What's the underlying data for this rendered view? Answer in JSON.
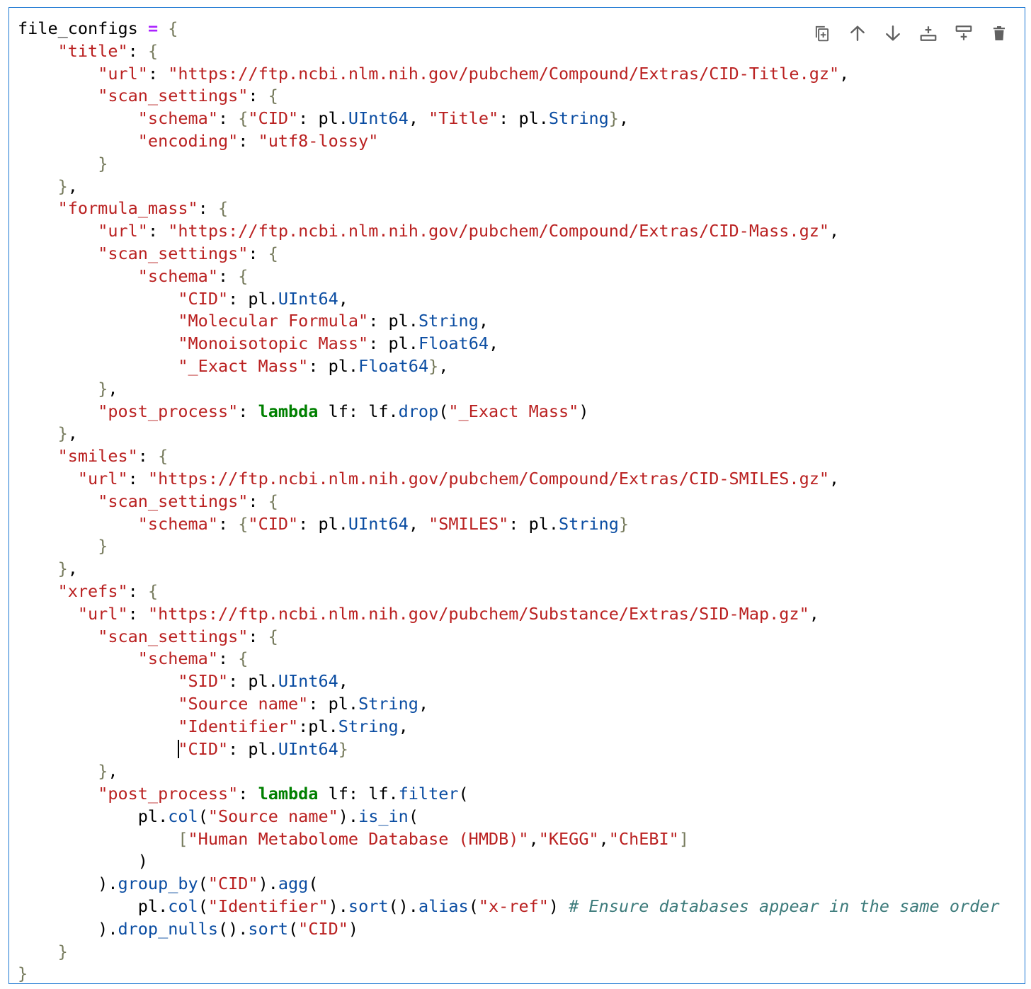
{
  "toolbar": {
    "buttons": [
      {
        "name": "duplicate-cell-button",
        "icon": "duplicate-icon"
      },
      {
        "name": "move-up-button",
        "icon": "arrow-up-icon"
      },
      {
        "name": "move-down-button",
        "icon": "arrow-down-icon"
      },
      {
        "name": "insert-above-button",
        "icon": "insert-above-icon"
      },
      {
        "name": "insert-below-button",
        "icon": "insert-below-icon"
      },
      {
        "name": "delete-cell-button",
        "icon": "trash-icon"
      }
    ],
    "icon_color": "#616161"
  },
  "editor": {
    "cursor_line": 32,
    "accent": "#1976d2",
    "lines": [
      [
        [
          "file_configs ",
          "default"
        ],
        [
          "=",
          "op"
        ],
        [
          " ",
          "default"
        ],
        [
          "{",
          "brace"
        ]
      ],
      [
        [
          "    ",
          "default"
        ],
        [
          "\"title\"",
          "key"
        ],
        [
          ": ",
          "default"
        ],
        [
          "{",
          "brace"
        ]
      ],
      [
        [
          "        ",
          "default"
        ],
        [
          "\"url\"",
          "key"
        ],
        [
          ": ",
          "default"
        ],
        [
          "\"https://ftp.ncbi.nlm.nih.gov/pubchem/Compound/Extras/CID-Title.gz\"",
          "string"
        ],
        [
          ",",
          "default"
        ]
      ],
      [
        [
          "        ",
          "default"
        ],
        [
          "\"scan_settings\"",
          "key"
        ],
        [
          ": ",
          "default"
        ],
        [
          "{",
          "brace"
        ]
      ],
      [
        [
          "            ",
          "default"
        ],
        [
          "\"schema\"",
          "key"
        ],
        [
          ": ",
          "default"
        ],
        [
          "{",
          "brace"
        ],
        [
          "\"CID\"",
          "string"
        ],
        [
          ": pl.",
          "default"
        ],
        [
          "UInt64",
          "attr"
        ],
        [
          ", ",
          "default"
        ],
        [
          "\"Title\"",
          "string"
        ],
        [
          ": pl.",
          "default"
        ],
        [
          "String",
          "attr"
        ],
        [
          "}",
          "brace"
        ],
        [
          ",",
          "default"
        ]
      ],
      [
        [
          "            ",
          "default"
        ],
        [
          "\"encoding\"",
          "key"
        ],
        [
          ": ",
          "default"
        ],
        [
          "\"utf8-lossy\"",
          "string"
        ]
      ],
      [
        [
          "        ",
          "default"
        ],
        [
          "}",
          "brace"
        ]
      ],
      [
        [
          "    ",
          "default"
        ],
        [
          "}",
          "brace"
        ],
        [
          ",",
          "default"
        ]
      ],
      [
        [
          "    ",
          "default"
        ],
        [
          "\"formula_mass\"",
          "key"
        ],
        [
          ": ",
          "default"
        ],
        [
          "{",
          "brace"
        ]
      ],
      [
        [
          "        ",
          "default"
        ],
        [
          "\"url\"",
          "key"
        ],
        [
          ": ",
          "default"
        ],
        [
          "\"https://ftp.ncbi.nlm.nih.gov/pubchem/Compound/Extras/CID-Mass.gz\"",
          "string"
        ],
        [
          ",",
          "default"
        ]
      ],
      [
        [
          "        ",
          "default"
        ],
        [
          "\"scan_settings\"",
          "key"
        ],
        [
          ": ",
          "default"
        ],
        [
          "{",
          "brace"
        ]
      ],
      [
        [
          "            ",
          "default"
        ],
        [
          "\"schema\"",
          "key"
        ],
        [
          ": ",
          "default"
        ],
        [
          "{",
          "brace"
        ]
      ],
      [
        [
          "                ",
          "default"
        ],
        [
          "\"CID\"",
          "string"
        ],
        [
          ": pl.",
          "default"
        ],
        [
          "UInt64",
          "attr"
        ],
        [
          ",",
          "default"
        ]
      ],
      [
        [
          "                ",
          "default"
        ],
        [
          "\"Molecular Formula\"",
          "string"
        ],
        [
          ": pl.",
          "default"
        ],
        [
          "String",
          "attr"
        ],
        [
          ",",
          "default"
        ]
      ],
      [
        [
          "                ",
          "default"
        ],
        [
          "\"Monoisotopic Mass\"",
          "string"
        ],
        [
          ": pl.",
          "default"
        ],
        [
          "Float64",
          "attr"
        ],
        [
          ",",
          "default"
        ]
      ],
      [
        [
          "                ",
          "default"
        ],
        [
          "\"_Exact Mass\"",
          "string"
        ],
        [
          ": pl.",
          "default"
        ],
        [
          "Float64",
          "attr"
        ],
        [
          "}",
          "brace"
        ],
        [
          ",",
          "default"
        ]
      ],
      [
        [
          "        ",
          "default"
        ],
        [
          "}",
          "brace"
        ],
        [
          ",",
          "default"
        ]
      ],
      [
        [
          "        ",
          "default"
        ],
        [
          "\"post_process\"",
          "key"
        ],
        [
          ": ",
          "default"
        ],
        [
          "lambda",
          "keyword"
        ],
        [
          " lf: lf.",
          "default"
        ],
        [
          "drop",
          "attr"
        ],
        [
          "(",
          "default"
        ],
        [
          "\"_Exact Mass\"",
          "string"
        ],
        [
          ")",
          "default"
        ]
      ],
      [
        [
          "    ",
          "default"
        ],
        [
          "}",
          "brace"
        ],
        [
          ",",
          "default"
        ]
      ],
      [
        [
          "    ",
          "default"
        ],
        [
          "\"smiles\"",
          "key"
        ],
        [
          ": ",
          "default"
        ],
        [
          "{",
          "brace"
        ]
      ],
      [
        [
          "      ",
          "default"
        ],
        [
          "\"url\"",
          "key"
        ],
        [
          ": ",
          "default"
        ],
        [
          "\"https://ftp.ncbi.nlm.nih.gov/pubchem/Compound/Extras/CID-SMILES.gz\"",
          "string"
        ],
        [
          ",",
          "default"
        ]
      ],
      [
        [
          "        ",
          "default"
        ],
        [
          "\"scan_settings\"",
          "key"
        ],
        [
          ": ",
          "default"
        ],
        [
          "{",
          "brace"
        ]
      ],
      [
        [
          "            ",
          "default"
        ],
        [
          "\"schema\"",
          "key"
        ],
        [
          ": ",
          "default"
        ],
        [
          "{",
          "brace"
        ],
        [
          "\"CID\"",
          "string"
        ],
        [
          ": pl.",
          "default"
        ],
        [
          "UInt64",
          "attr"
        ],
        [
          ", ",
          "default"
        ],
        [
          "\"SMILES\"",
          "string"
        ],
        [
          ": pl.",
          "default"
        ],
        [
          "String",
          "attr"
        ],
        [
          "}",
          "brace"
        ]
      ],
      [
        [
          "        ",
          "default"
        ],
        [
          "}",
          "brace"
        ]
      ],
      [
        [
          "    ",
          "default"
        ],
        [
          "}",
          "brace"
        ],
        [
          ",",
          "default"
        ]
      ],
      [
        [
          "    ",
          "default"
        ],
        [
          "\"xrefs\"",
          "key"
        ],
        [
          ": ",
          "default"
        ],
        [
          "{",
          "brace"
        ]
      ],
      [
        [
          "      ",
          "default"
        ],
        [
          "\"url\"",
          "key"
        ],
        [
          ": ",
          "default"
        ],
        [
          "\"https://ftp.ncbi.nlm.nih.gov/pubchem/Substance/Extras/SID-Map.gz\"",
          "string"
        ],
        [
          ",",
          "default"
        ]
      ],
      [
        [
          "        ",
          "default"
        ],
        [
          "\"scan_settings\"",
          "key"
        ],
        [
          ": ",
          "default"
        ],
        [
          "{",
          "brace"
        ]
      ],
      [
        [
          "            ",
          "default"
        ],
        [
          "\"schema\"",
          "key"
        ],
        [
          ": ",
          "default"
        ],
        [
          "{",
          "brace"
        ]
      ],
      [
        [
          "                ",
          "default"
        ],
        [
          "\"SID\"",
          "string"
        ],
        [
          ": pl.",
          "default"
        ],
        [
          "UInt64",
          "attr"
        ],
        [
          ",",
          "default"
        ]
      ],
      [
        [
          "                ",
          "default"
        ],
        [
          "\"Source name\"",
          "string"
        ],
        [
          ": pl.",
          "default"
        ],
        [
          "String",
          "attr"
        ],
        [
          ",",
          "default"
        ]
      ],
      [
        [
          "                ",
          "default"
        ],
        [
          "\"Identifier\"",
          "string"
        ],
        [
          ":pl.",
          "default"
        ],
        [
          "String",
          "attr"
        ],
        [
          ",",
          "default"
        ]
      ],
      [
        [
          "                ",
          "default"
        ],
        [
          "\"CID\"",
          "string"
        ],
        [
          ": pl.",
          "default"
        ],
        [
          "UInt64",
          "attr"
        ],
        [
          "}",
          "brace"
        ]
      ],
      [
        [
          "        ",
          "default"
        ],
        [
          "}",
          "brace"
        ],
        [
          ",",
          "default"
        ]
      ],
      [
        [
          "        ",
          "default"
        ],
        [
          "\"post_process\"",
          "key"
        ],
        [
          ": ",
          "default"
        ],
        [
          "lambda",
          "keyword"
        ],
        [
          " lf: lf.",
          "default"
        ],
        [
          "filter",
          "attr"
        ],
        [
          "(",
          "default"
        ]
      ],
      [
        [
          "            pl.",
          "default"
        ],
        [
          "col",
          "attr"
        ],
        [
          "(",
          "default"
        ],
        [
          "\"Source name\"",
          "string"
        ],
        [
          ").",
          "default"
        ],
        [
          "is_in",
          "attr"
        ],
        [
          "(",
          "default"
        ]
      ],
      [
        [
          "                ",
          "default"
        ],
        [
          "[",
          "brace"
        ],
        [
          "\"Human Metabolome Database (HMDB)\"",
          "string"
        ],
        [
          ",",
          "default"
        ],
        [
          "\"KEGG\"",
          "string"
        ],
        [
          ",",
          "default"
        ],
        [
          "\"ChEBI\"",
          "string"
        ],
        [
          "]",
          "brace"
        ]
      ],
      [
        [
          "            )",
          "default"
        ]
      ],
      [
        [
          "        ).",
          "default"
        ],
        [
          "group_by",
          "attr"
        ],
        [
          "(",
          "default"
        ],
        [
          "\"CID\"",
          "string"
        ],
        [
          ").",
          "default"
        ],
        [
          "agg",
          "attr"
        ],
        [
          "(",
          "default"
        ]
      ],
      [
        [
          "            pl.",
          "default"
        ],
        [
          "col",
          "attr"
        ],
        [
          "(",
          "default"
        ],
        [
          "\"Identifier\"",
          "string"
        ],
        [
          ").",
          "default"
        ],
        [
          "sort",
          "attr"
        ],
        [
          "().",
          "default"
        ],
        [
          "alias",
          "attr"
        ],
        [
          "(",
          "default"
        ],
        [
          "\"x-ref\"",
          "string"
        ],
        [
          ") ",
          "default"
        ],
        [
          "# Ensure databases appear in the same order",
          "comment"
        ]
      ],
      [
        [
          "        ).",
          "default"
        ],
        [
          "drop_nulls",
          "attr"
        ],
        [
          "().",
          "default"
        ],
        [
          "sort",
          "attr"
        ],
        [
          "(",
          "default"
        ],
        [
          "\"CID\"",
          "string"
        ],
        [
          ")",
          "default"
        ]
      ],
      [
        [
          "    ",
          "default"
        ],
        [
          "}",
          "brace"
        ]
      ],
      [
        [
          "}",
          "brace"
        ]
      ]
    ]
  }
}
